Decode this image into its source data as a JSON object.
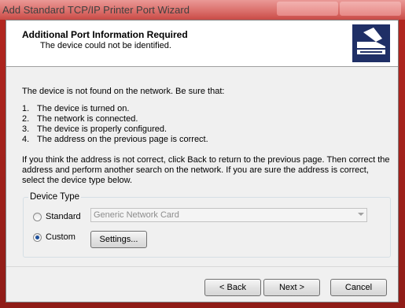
{
  "window": {
    "title": "Add Standard TCP/IP Printer Port Wizard"
  },
  "header": {
    "title": "Additional Port Information Required",
    "subtitle": "The device could not be identified."
  },
  "intro": "The device is not found on the network.  Be sure that:",
  "checklist": [
    {
      "num": "1.",
      "text": "The device is turned on."
    },
    {
      "num": "2.",
      "text": "The network is connected."
    },
    {
      "num": "3.",
      "text": "The device is properly configured."
    },
    {
      "num": "4.",
      "text": "The address on the previous page is correct."
    }
  ],
  "instructions": "If you think the address is not correct, click Back to return to the previous page.  Then correct the address and perform another search on the network.  If you are sure the address is correct, select the device type below.",
  "device_type": {
    "legend": "Device Type",
    "standard_label": "Standard",
    "standard_value": "Generic Network Card",
    "custom_label": "Custom",
    "selected": "Custom",
    "settings_label": "Settings..."
  },
  "footer": {
    "back_label": "< Back",
    "next_label": "Next >",
    "cancel_label": "Cancel"
  }
}
